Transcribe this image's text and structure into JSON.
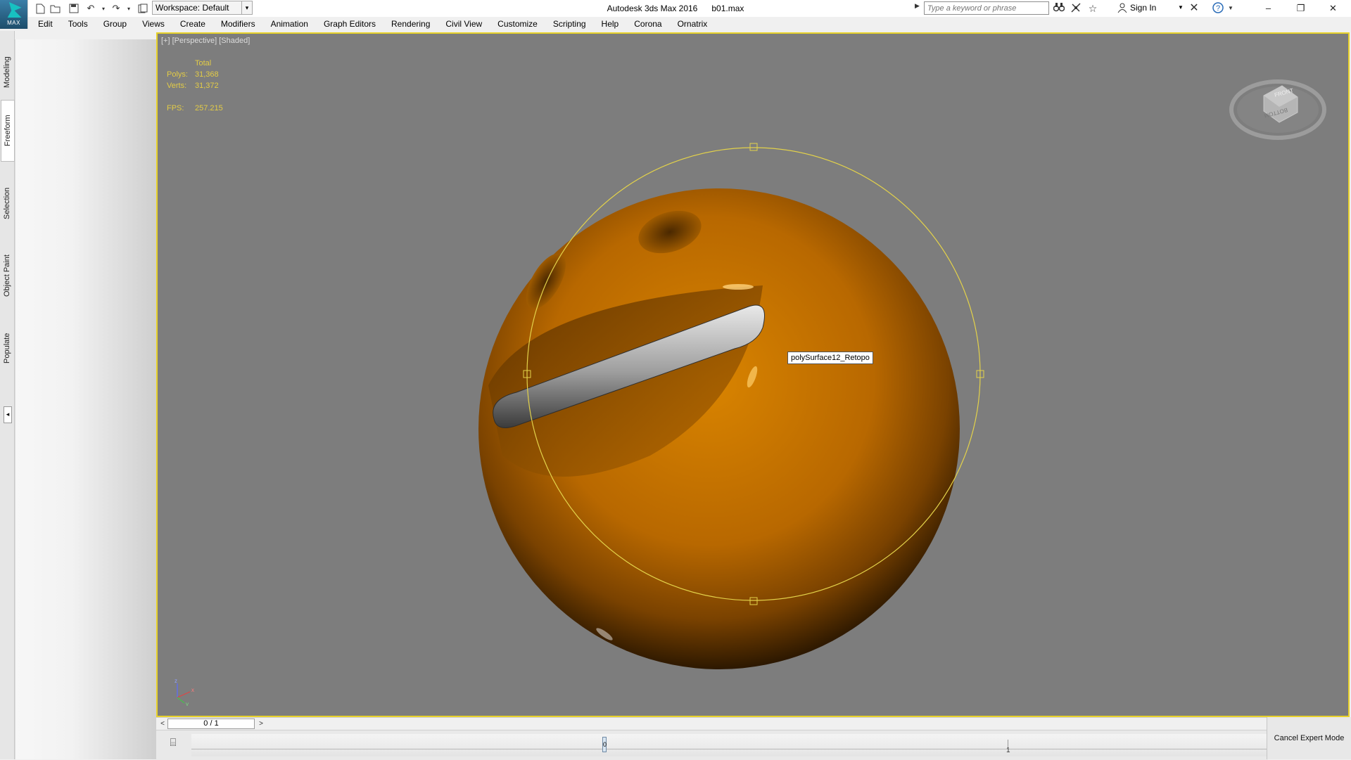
{
  "app": {
    "window_title": "Autodesk 3ds Max 2016",
    "file_name": "b01.max",
    "logo_text": "MAX"
  },
  "quick_access": {
    "workspace_label": "Workspace: Default",
    "icons": [
      "new-file-icon",
      "open-file-icon",
      "save-icon",
      "undo-icon",
      "redo-icon",
      "project-folder-icon"
    ]
  },
  "infocenter": {
    "search_placeholder": "Type a keyword or phrase",
    "sign_in_label": "Sign In",
    "icons": [
      "binoculars-icon",
      "communication-center-icon",
      "favorites-star-icon",
      "user-icon",
      "exchange-apps-icon",
      "help-icon"
    ]
  },
  "window_controls": {
    "minimize": "–",
    "restore": "❐",
    "close": "✕"
  },
  "menu": {
    "items": [
      "Edit",
      "Tools",
      "Group",
      "Views",
      "Create",
      "Modifiers",
      "Animation",
      "Graph Editors",
      "Rendering",
      "Civil View",
      "Customize",
      "Scripting",
      "Help",
      "Corona",
      "Ornatrix"
    ]
  },
  "ribbon": {
    "tabs": [
      "Modeling",
      "Freeform",
      "Selection",
      "Object Paint",
      "Populate"
    ],
    "active_tab": "Freeform"
  },
  "viewport": {
    "label": "[+] [Perspective] [Shaded]",
    "stats": {
      "header": "Total",
      "polys_label": "Polys:",
      "polys_value": "31,368",
      "verts_label": "Verts:",
      "verts_value": "31,372",
      "fps_label": "FPS:",
      "fps_value": "257.215"
    },
    "selected_object_tooltip": "polySurface12_Retopo",
    "viewcube_labels": {
      "top": "FRONT",
      "bottom": "BOTTOM"
    },
    "axes": {
      "x": "x",
      "y": "y",
      "z": "z"
    },
    "colors": {
      "viewport_bg": "#7d7d7d",
      "active_border": "#e8d22a",
      "stats_text": "#e3cc46",
      "object_orange": "#c97200"
    }
  },
  "timeline": {
    "prev_label": "<",
    "next_label": ">",
    "frame_readout": "0 / 1",
    "current_frame": "0",
    "end_tick_label": "1"
  },
  "expert_mode": {
    "cancel_label": "Cancel Expert Mode"
  }
}
